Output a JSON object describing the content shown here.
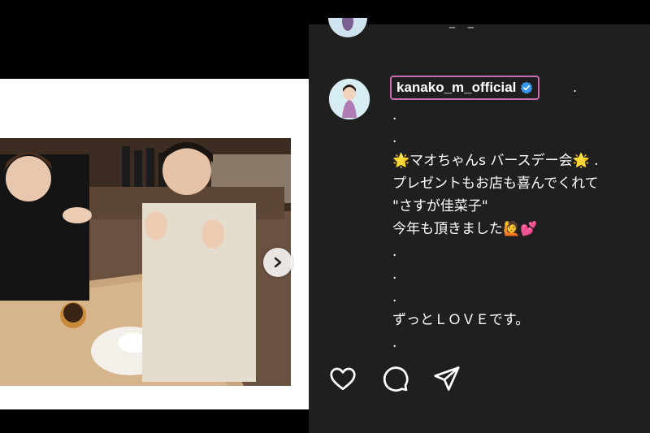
{
  "post": {
    "username": "kanako_m_official",
    "username_suffix": ".",
    "caption_lines": [
      ".",
      ".",
      "🌟マオちゃんs バースデー会🌟 .",
      "プレゼントもお店も喜んでくれて",
      "\"さすが佳菜子\"",
      "今年も頂きました🙋💕",
      ".",
      ".",
      ".",
      "ずっとＬＯＶＥです。",
      "."
    ]
  },
  "icons": {
    "verified": "verified-badge-icon",
    "next": "chevron-right-icon",
    "like": "heart-icon",
    "comment": "comment-icon",
    "share": "send-icon"
  },
  "colors": {
    "panel_bg": "#1f1f1f",
    "username_border": "#c86bb0",
    "verified_blue": "#3897f0"
  }
}
